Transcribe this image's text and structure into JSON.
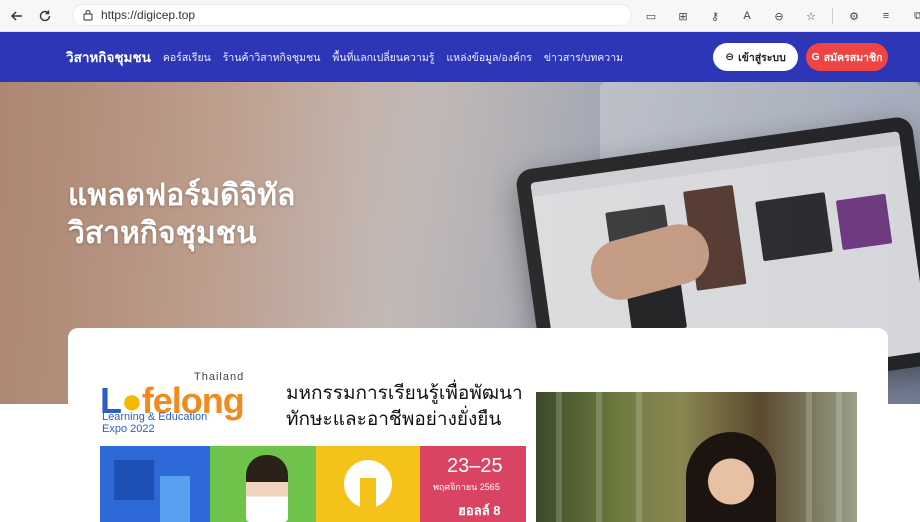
{
  "browser": {
    "url": "https://digicep.top"
  },
  "nav": {
    "logo": "วิสาหกิจชุมชน",
    "items": [
      "คอร์สเรียน",
      "ร้านค้าวิสาหกิจชุมชน",
      "พื้นที่แลกเปลี่ยนความรู้",
      "แหล่งข้อมูล/องค์กร",
      "ข่าวสาร/บทความ"
    ],
    "login_label": "เข้าสู่ระบบ",
    "register_label": "สมัครสมาชิก",
    "colors": {
      "nav_bg": "#2e36b8",
      "register_bg": "#ef4444"
    }
  },
  "hero": {
    "title_line1": "แพลตฟอร์มดิจิทัล",
    "title_line2": "วิสาหกิจชุมชน"
  },
  "banner": {
    "lf_thailand": "Thailand",
    "lf_word_a": "L",
    "lf_word_b": "felong",
    "lf_sub1": "Learning & Education",
    "lf_sub2": "Expo 2022",
    "thai_head1": "มหกรรมการเรียนรู้เพื่อพัฒนา",
    "thai_head2": "ทักษะและอาชีพอย่างยั่งยืน",
    "date_range": "23–25",
    "date_month": "พฤศจิกายน 2565",
    "hall": "ฮอลล์ 8"
  }
}
